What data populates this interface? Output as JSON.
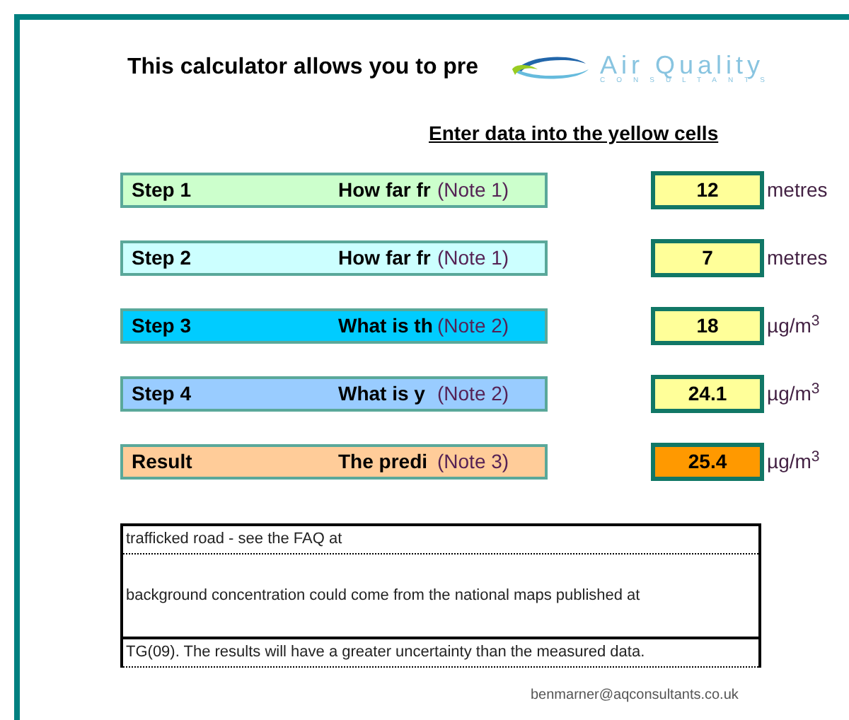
{
  "title": "This calculator allows you to pre",
  "logo": {
    "name": "Air Quality",
    "tagline": "CONSULTANTS"
  },
  "instruction": "Enter data into the yellow cells",
  "rows": [
    {
      "label": "Step 1",
      "question": "How far fr",
      "note": "(Note 1)",
      "color": "#ccffcc",
      "value": "12",
      "unit": "metres",
      "kind": "input"
    },
    {
      "label": "Step 2",
      "question": "How far fr",
      "note": "(Note 1)",
      "color": "#ccffff",
      "value": "7",
      "unit": "metres",
      "kind": "input"
    },
    {
      "label": "Step 3",
      "question": "What is th",
      "note": "(Note 2)",
      "color": "#00ccff",
      "value": "18",
      "unit": "µg/m$^{3}$",
      "kind": "input"
    },
    {
      "label": "Step 4",
      "question": "What is y",
      "note": "(Note 2)",
      "color": "#99ccff",
      "value": "24.1",
      "unit": "µg/m$^{3}$",
      "kind": "input"
    },
    {
      "label": "Result",
      "question": "The predi",
      "note": "(Note 3)",
      "color": "#ffcc99",
      "value": "25.4",
      "unit": "µg/m$^{3}$",
      "kind": "result"
    }
  ],
  "notes": [
    "trafficked road - see the FAQ at",
    "background concentration could come from the national maps published at",
    "TG(09).  The results will have a greater uncertainty than the measured data."
  ],
  "email": "benmarner@aqconsultants.co.uk"
}
